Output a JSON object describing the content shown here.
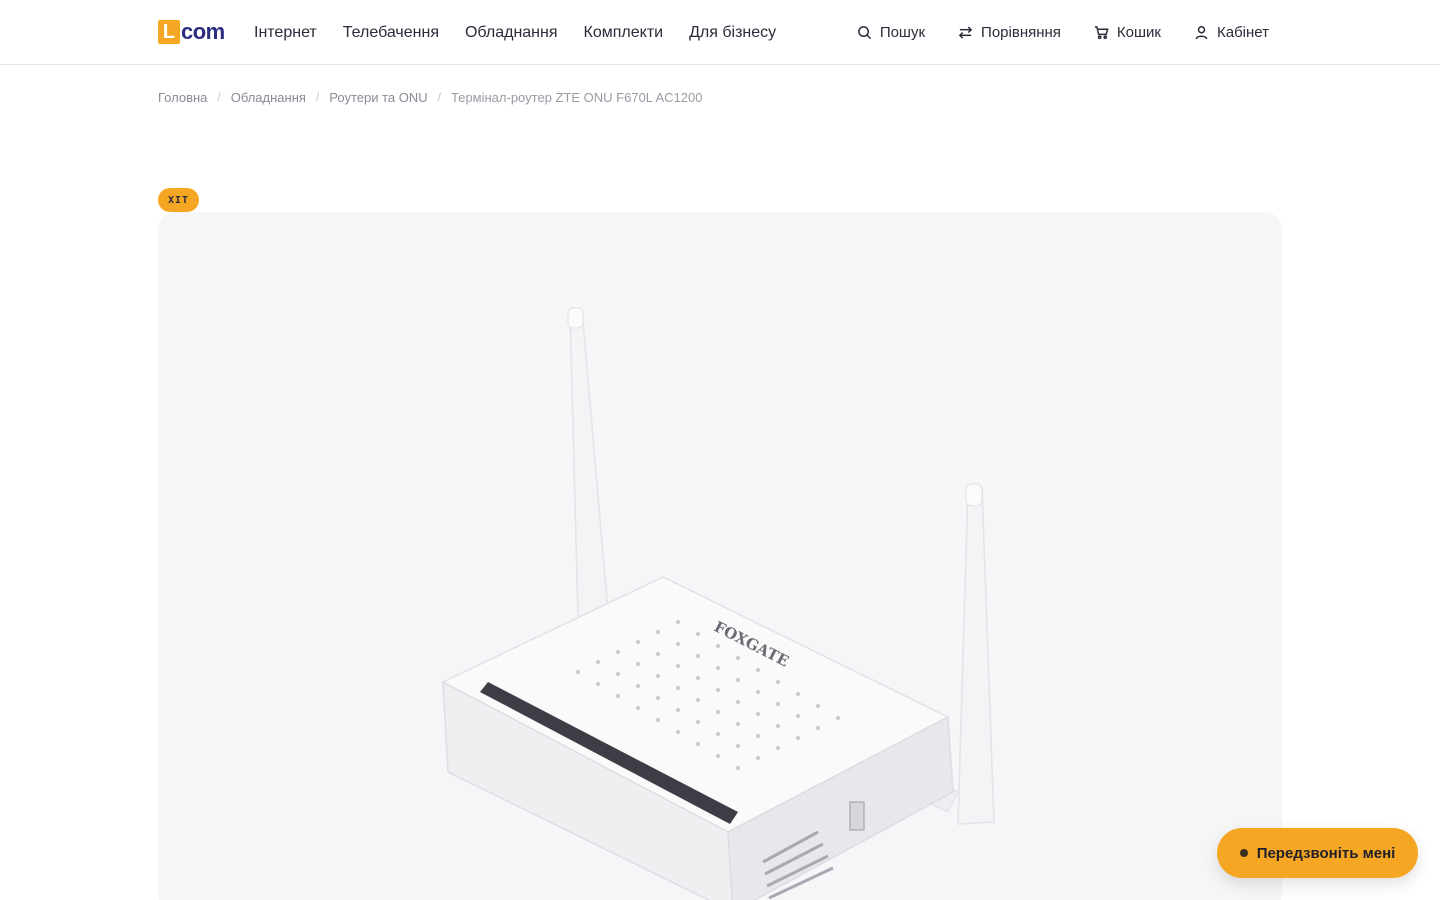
{
  "header": {
    "logo": {
      "mark": "L",
      "text": "com"
    },
    "nav": [
      {
        "label": "Інтернет"
      },
      {
        "label": "Телебачення"
      },
      {
        "label": "Обладнання"
      },
      {
        "label": "Комплекти"
      },
      {
        "label": "Для бізнесу"
      }
    ],
    "utility": {
      "search": "Пошук",
      "compare": "Порівняння",
      "cart": "Кошик",
      "account": "Кабінет"
    }
  },
  "breadcrumb": [
    "Головна",
    "Обладнання",
    "Роутери та ONU",
    "Термінал-роутер ZTE ONU F670L AC1200"
  ],
  "product": {
    "badge": "ХІТ",
    "image_brand_text": "FOXGATE"
  },
  "callback_button": "Передзвоніть мені",
  "colors": {
    "accent": "#f5a623",
    "brand_dark": "#2b2e7e",
    "text": "#2b2b3a",
    "muted": "#8a8a96",
    "gallery_bg": "#f6f6f8"
  }
}
